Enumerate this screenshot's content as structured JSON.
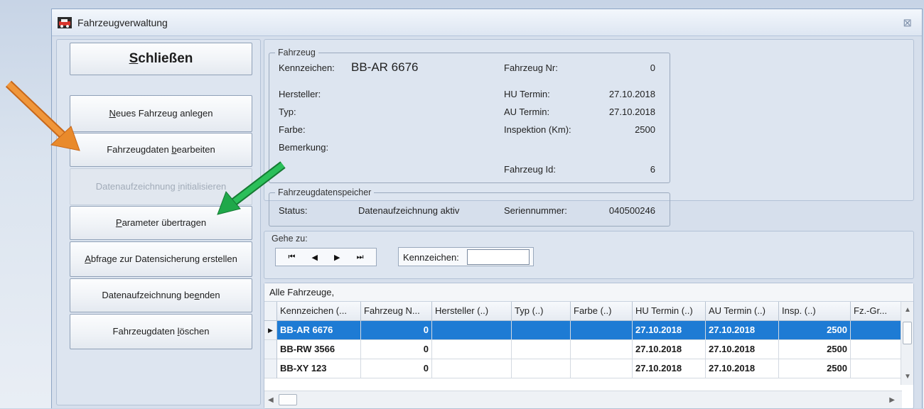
{
  "window": {
    "title": "Fahrzeugverwaltung",
    "close_glyph": "⊠"
  },
  "sidebar": {
    "close_button": {
      "prefix": "S",
      "rest": "chließen"
    },
    "buttons": [
      {
        "prefix": "",
        "hot": "N",
        "rest": "eues Fahrzeug anlegen",
        "enabled": true
      },
      {
        "prefix": "Fahrzeugdaten ",
        "hot": "b",
        "rest": "earbeiten",
        "enabled": true
      },
      {
        "prefix": "Datenaufzeichnung ",
        "hot": "i",
        "rest": "nitialisieren",
        "enabled": false
      },
      {
        "prefix": "",
        "hot": "P",
        "rest": "arameter übertragen",
        "enabled": true
      },
      {
        "prefix": "",
        "hot": "A",
        "rest": "bfrage zur Datensicherung erstellen",
        "enabled": true
      },
      {
        "prefix": "Datenaufzeichnung be",
        "hot": "e",
        "rest": "nden",
        "enabled": true
      },
      {
        "prefix": "Fahrzeugdaten ",
        "hot": "l",
        "rest": "öschen",
        "enabled": true
      }
    ]
  },
  "vehicle": {
    "legend": "Fahrzeug",
    "kennzeichen_label": "Kennzeichen:",
    "kennzeichen_value": "BB-AR 6676",
    "nr_label": "Fahrzeug Nr:",
    "nr_value": "0",
    "hersteller_label": "Hersteller:",
    "typ_label": "Typ:",
    "farbe_label": "Farbe:",
    "bemerkung_label": "Bemerkung:",
    "hu_label": "HU Termin:",
    "hu_value": "27.10.2018",
    "au_label": "AU Termin:",
    "au_value": "27.10.2018",
    "insp_label": "Inspektion (Km):",
    "insp_value": "2500",
    "id_label": "Fahrzeug Id:",
    "id_value": "6"
  },
  "storage": {
    "legend": "Fahrzeugdatenspeicher",
    "status_label": "Status:",
    "status_value": "Datenaufzeichnung aktiv",
    "serial_label": "Seriennummer:",
    "serial_value": "040500246"
  },
  "goto": {
    "legend": "Gehe zu:",
    "nav": {
      "first": "⏮",
      "prev": "◀",
      "next": "▶",
      "last": "⏭"
    },
    "kennzeichen_label": "Kennzeichen:",
    "kennzeichen_value": ""
  },
  "grid": {
    "caption": "Alle Fahrzeuge,",
    "columns": [
      "Kennzeichen (...",
      "Fahrzeug N...",
      "Hersteller (..)",
      "Typ (..)",
      "Farbe (..)",
      "HU Termin (..)",
      "AU Termin (..)",
      "Insp. (..)",
      "Fz.-Gr..."
    ],
    "rows": [
      [
        "BB-AR 6676",
        "0",
        "",
        "",
        "",
        "27.10.2018",
        "27.10.2018",
        "2500",
        ""
      ],
      [
        "BB-RW 3566",
        "0",
        "",
        "",
        "",
        "27.10.2018",
        "27.10.2018",
        "2500",
        ""
      ],
      [
        "BB-XY 123",
        "0",
        "",
        "",
        "",
        "27.10.2018",
        "27.10.2018",
        "2500",
        ""
      ]
    ],
    "selected_row": 0
  },
  "colors": {
    "selection": "#1e7bd4",
    "arrow_orange": "#e98a2b",
    "arrow_green": "#1fa84a"
  }
}
